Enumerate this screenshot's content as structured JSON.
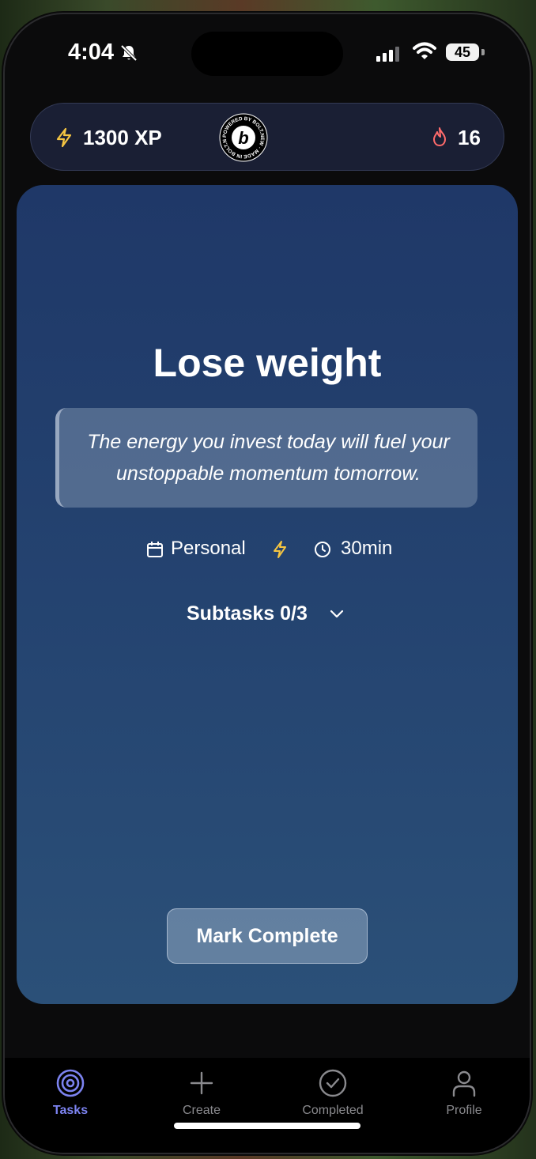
{
  "status_bar": {
    "time": "4:04",
    "battery": "45"
  },
  "header": {
    "xp": "1300 XP",
    "streak": "16",
    "badge_text": "POWERED BY BOLT.NEW · MADE IN BOLT.NEW ·",
    "badge_letter": "b"
  },
  "task": {
    "title": "Lose weight",
    "quote": "The energy you invest today will fuel your unstoppable momentum tomorrow.",
    "category": "Personal",
    "duration": "30min",
    "subtasks_label": "Subtasks 0/3",
    "complete_label": "Mark Complete"
  },
  "tabs": [
    {
      "label": "Tasks",
      "icon": "target-icon",
      "active": true
    },
    {
      "label": "Create",
      "icon": "plus-icon",
      "active": false
    },
    {
      "label": "Completed",
      "icon": "check-circle-icon",
      "active": false
    },
    {
      "label": "Profile",
      "icon": "user-icon",
      "active": false
    }
  ],
  "colors": {
    "accent": "#7c83f0",
    "xp_yellow": "#f5c542",
    "flame_red": "#ff6b6b",
    "card_top": "#1f3868",
    "card_bottom": "#2b5078"
  }
}
